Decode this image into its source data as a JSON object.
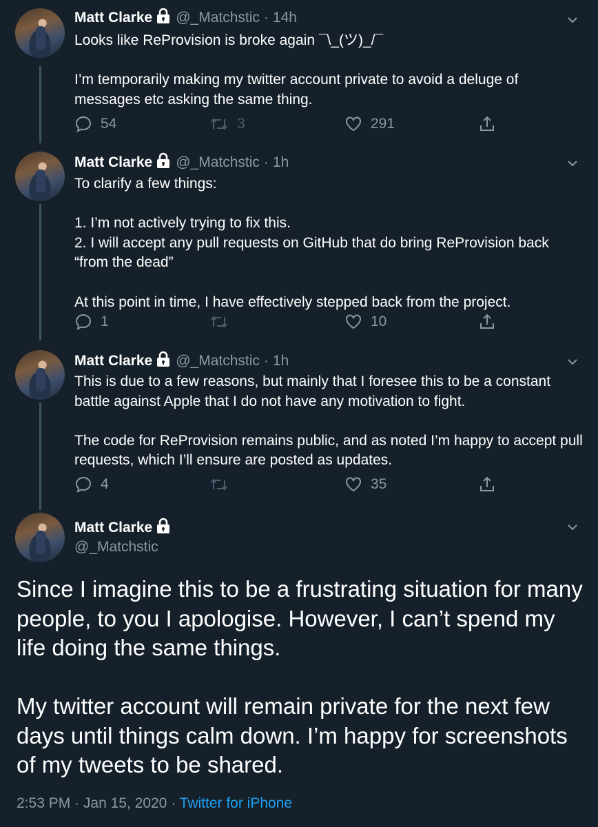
{
  "tweets": [
    {
      "name": "Matt Clarke",
      "handle": "@_Matchstic",
      "time": "14h",
      "text": "Looks like ReProvision is broke again ¯\\_(ツ)_/¯\n\nI’m temporarily making my twitter account private to avoid a deluge of messages etc asking the same thing.",
      "replies": "54",
      "retweets": "3",
      "likes": "291"
    },
    {
      "name": "Matt Clarke",
      "handle": "@_Matchstic",
      "time": "1h",
      "text": "To clarify a few things:\n\n1. I’m not actively trying to fix this.\n2. I will accept any pull requests on GitHub that do bring ReProvision back “from the dead”\n\nAt this point in time, I have effectively stepped back from the project.",
      "replies": "1",
      "retweets": "",
      "likes": "10"
    },
    {
      "name": "Matt Clarke",
      "handle": "@_Matchstic",
      "time": "1h",
      "text": "This is due to a few reasons, but mainly that I foresee this to be a constant battle against Apple that I do not have any motivation to fight.\n\nThe code for ReProvision remains public, and as noted I’m happy to accept pull requests, which I’ll ensure are posted as updates.",
      "replies": "4",
      "retweets": "",
      "likes": "35"
    }
  ],
  "main_tweet": {
    "name": "Matt Clarke",
    "handle": "@_Matchstic",
    "text": "Since I imagine this to be a frustrating situation for many people, to you I apologise. However, I can’t spend my life doing the same things.\n\nMy twitter account will remain private for the next few days until things calm down. I’m happy for screenshots of my tweets to be shared.",
    "time": "2:53 PM",
    "date": "Jan 15, 2020",
    "source": "Twitter for iPhone"
  },
  "separators": {
    "dot": "·"
  },
  "colors": {
    "background": "#16202b",
    "secondary_text": "#8899a6",
    "link": "#1da1f2",
    "thread_line": "#3d5466"
  },
  "icons": [
    "lock-icon",
    "chevron-down-icon",
    "reply-icon",
    "retweet-icon",
    "like-icon",
    "share-icon"
  ]
}
